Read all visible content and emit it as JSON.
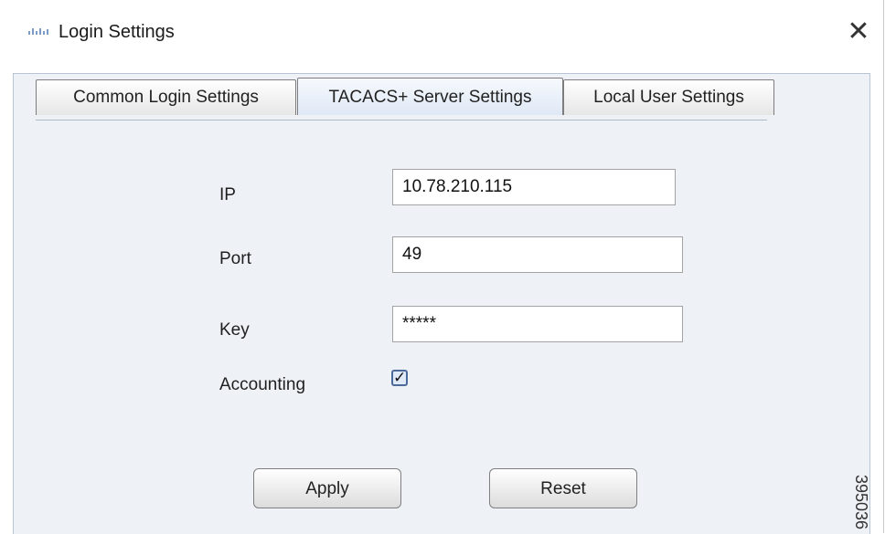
{
  "window": {
    "title": "Login Settings",
    "close_glyph": "✕",
    "app_icon": "cisco-icon"
  },
  "tabs": [
    {
      "label": "Common Login Settings",
      "active": false
    },
    {
      "label": "TACACS+ Server Settings",
      "active": true
    },
    {
      "label": "Local User Settings",
      "active": false
    }
  ],
  "form": {
    "ip": {
      "label": "IP",
      "value": "10.78.210.115"
    },
    "port": {
      "label": "Port",
      "value": "49"
    },
    "key": {
      "label": "Key",
      "value": "*****"
    },
    "accounting": {
      "label": "Accounting",
      "checked": true,
      "glyph": "✓"
    }
  },
  "buttons": {
    "apply": "Apply",
    "reset": "Reset"
  },
  "watermark": "395036"
}
